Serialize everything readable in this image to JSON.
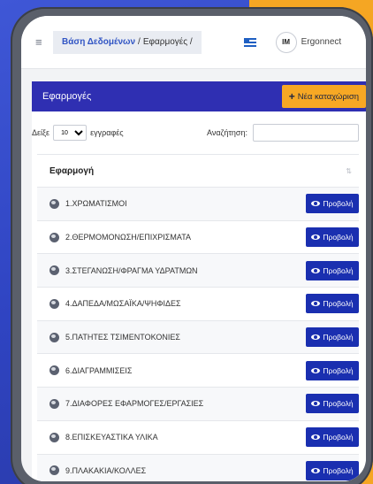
{
  "topbar": {
    "menu_glyph": "≡",
    "breadcrumb": {
      "root": "Βάση Δεδομένων",
      "sep": "/",
      "current": "Εφαρμογές /"
    },
    "avatar_initials": "IM",
    "brand": "Ergonnect"
  },
  "card": {
    "title": "Εφαρμογές",
    "new_button": {
      "icon": "+",
      "label": "Νέα καταχώριση"
    }
  },
  "controls": {
    "show_prefix": "Δείξε",
    "page_size_selected": "10",
    "show_suffix": "εγγραφές",
    "search_label": "Αναζήτηση:",
    "search_value": ""
  },
  "table": {
    "column_header": "Εφαρμογή",
    "sort_glyph": "⇅",
    "view_label": "Προβολή",
    "rows": [
      "1.ΧΡΩΜΑΤΙΣΜΟΙ",
      "2.ΘΕΡΜΟΜΟΝΩΣΗ/ΕΠΙΧΡΙΣΜΑΤΑ",
      "3.ΣΤΕΓΑΝΩΣΗ/ΦΡΑΓΜΑ ΥΔΡΑΤΜΩΝ",
      "4.ΔΑΠΕΔΑ/ΜΩΣΑΪΚΑ/ΨΗΦΙΔΕΣ",
      "5.ΠΑΤΗΤΕΣ ΤΣΙΜΕΝΤΟΚΟΝΙΕΣ",
      "6.ΔΙΑΓΡΑΜΜΙΣΕΙΣ",
      "7.ΔΙΑΦΟΡΕΣ ΕΦΑΡΜΟΓΕΣ/ΕΡΓΑΣΙΕΣ",
      "8.ΕΠΙΣΚΕΥΑΣΤΙΚΑ ΥΛΙΚΑ",
      "9.ΠΛΑΚΑΚΙΑ/ΚΟΛΛΕΣ"
    ]
  },
  "colors": {
    "header_bg": "#2f2fb2",
    "accent_orange": "#f7a824",
    "button_blue": "#1a2fb0"
  }
}
